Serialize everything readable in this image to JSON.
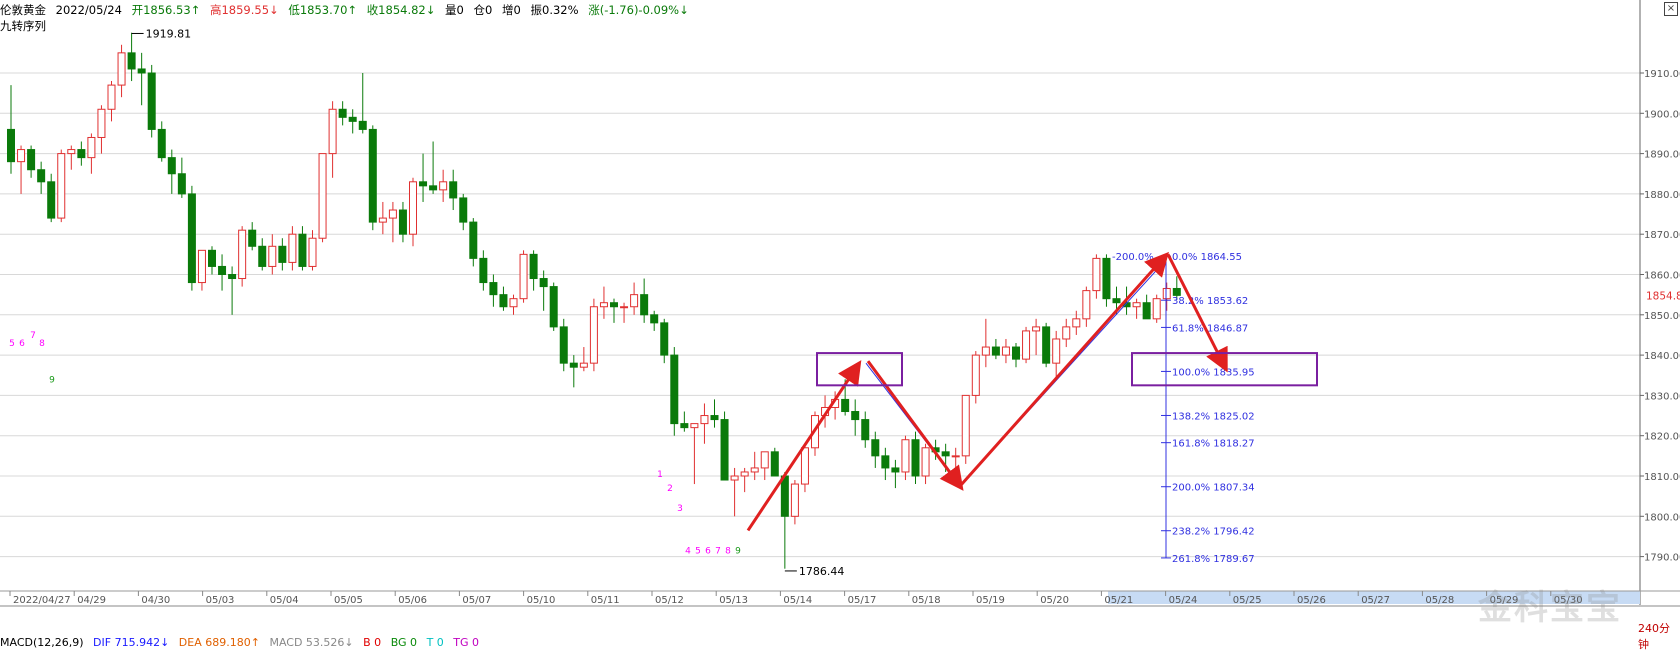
{
  "header": {
    "instrument": "伦敦黄金",
    "date": "2022/05/24",
    "open": "开1856.53↑",
    "high": "高1859.55↓",
    "low": "低1853.70↑",
    "close": "收1854.82↓",
    "volume": "量0",
    "open_interest": "仓0",
    "increase": "增0",
    "amplitude": "振0.32%",
    "change": "涨(-1.76)-0.09%↓",
    "subtitle": "九转序列"
  },
  "footer": {
    "macd_title": "MACD(12,26,9)",
    "dif": "DIF 715.942↓",
    "dea": "DEA 689.180↑",
    "macd": "MACD 53.526↓",
    "b": "B 0",
    "bg": "BG 0",
    "t": "T 0",
    "tg": "TG 0"
  },
  "watermark": "金科宝宝",
  "period_label": "240分钟",
  "colors": {
    "up": "#e03030",
    "down": "#0a7a0a",
    "fib": "#3030e0",
    "box": "#7a1fa0",
    "arrow": "#e02020"
  },
  "chart_data": {
    "type": "candlestick",
    "y_axis": {
      "ticks": [
        1790,
        1800,
        1810,
        1820,
        1830,
        1840,
        1850,
        1860,
        1870,
        1880,
        1890,
        1900,
        1910
      ],
      "range": [
        1787,
        1922
      ]
    },
    "current_price_label": "1854.82",
    "x_axis": {
      "date_labels": [
        "2022/04/27",
        "04/29",
        "04/30",
        "05/03",
        "05/04",
        "05/05",
        "05/06",
        "05/07",
        "05/10",
        "05/11",
        "05/12",
        "05/13",
        "05/14",
        "05/17",
        "05/18",
        "05/19",
        "05/20",
        "05/21",
        "05/24",
        "05/25",
        "05/26",
        "05/27",
        "05/28",
        "05/29",
        "05/30"
      ]
    },
    "candles": [
      [
        1896.0,
        1907.0,
        1885.0,
        1888.0
      ],
      [
        1888.0,
        1892.0,
        1880.0,
        1891.0
      ],
      [
        1891.0,
        1892.0,
        1884.0,
        1886.0
      ],
      [
        1886.0,
        1888.0,
        1880.0,
        1883.0
      ],
      [
        1883.0,
        1885.0,
        1873.0,
        1874.0
      ],
      [
        1874.0,
        1891.0,
        1873.0,
        1890.0
      ],
      [
        1890.0,
        1892.0,
        1886.0,
        1891.0
      ],
      [
        1891.0,
        1893.0,
        1887.0,
        1889.0
      ],
      [
        1889.0,
        1895.0,
        1885.0,
        1894.0
      ],
      [
        1894.0,
        1902.0,
        1890.0,
        1901.0
      ],
      [
        1901.0,
        1908.0,
        1898.0,
        1907.0
      ],
      [
        1907.0,
        1917.0,
        1904.0,
        1915.0
      ],
      [
        1915.0,
        1920.0,
        1908.0,
        1911.0
      ],
      [
        1911.0,
        1915.0,
        1902.0,
        1910.0
      ],
      [
        1910.0,
        1912.0,
        1894.0,
        1896.0
      ],
      [
        1896.0,
        1898.0,
        1888.0,
        1889.0
      ],
      [
        1889.0,
        1891.0,
        1880.0,
        1885.0
      ],
      [
        1885.0,
        1889.0,
        1879.0,
        1880.0
      ],
      [
        1880.0,
        1882.0,
        1856.0,
        1858.0
      ],
      [
        1858.0,
        1866.0,
        1856.0,
        1866.0
      ],
      [
        1866.0,
        1867.0,
        1860.0,
        1862.0
      ],
      [
        1862.0,
        1865.0,
        1856.0,
        1860.0
      ],
      [
        1860.0,
        1862.0,
        1850.0,
        1859.0
      ],
      [
        1859.0,
        1872.0,
        1857.0,
        1871.0
      ],
      [
        1871.0,
        1873.0,
        1866.0,
        1867.0
      ],
      [
        1867.0,
        1869.0,
        1861.0,
        1862.0
      ],
      [
        1862.0,
        1870.0,
        1860.0,
        1867.0
      ],
      [
        1867.0,
        1869.0,
        1861.0,
        1863.0
      ],
      [
        1863.0,
        1872.0,
        1861.0,
        1870.0
      ],
      [
        1870.0,
        1872.0,
        1861.0,
        1862.0
      ],
      [
        1862.0,
        1871.0,
        1861.0,
        1869.0
      ],
      [
        1869.0,
        1890.0,
        1868.0,
        1890.0
      ],
      [
        1890.0,
        1903.0,
        1884.0,
        1901.0
      ],
      [
        1901.0,
        1903.0,
        1897.0,
        1899.0
      ],
      [
        1899.0,
        1901.0,
        1895.0,
        1898.0
      ],
      [
        1898.0,
        1910.0,
        1895.0,
        1896.0
      ],
      [
        1896.0,
        1897.0,
        1871.0,
        1873.0
      ],
      [
        1873.0,
        1878.0,
        1870.0,
        1874.0
      ],
      [
        1874.0,
        1878.0,
        1868.0,
        1876.0
      ],
      [
        1876.0,
        1878.0,
        1868.0,
        1870.0
      ],
      [
        1870.0,
        1884.0,
        1867.0,
        1883.0
      ],
      [
        1883.0,
        1890.0,
        1878.0,
        1882.0
      ],
      [
        1882.0,
        1893.0,
        1880.0,
        1881.0
      ],
      [
        1881.0,
        1886.0,
        1878.0,
        1883.0
      ],
      [
        1883.0,
        1886.0,
        1876.0,
        1879.0
      ],
      [
        1879.0,
        1880.0,
        1871.0,
        1873.0
      ],
      [
        1873.0,
        1874.0,
        1862.0,
        1864.0
      ],
      [
        1864.0,
        1866.0,
        1856.0,
        1858.0
      ],
      [
        1858.0,
        1860.0,
        1852.0,
        1855.0
      ],
      [
        1855.0,
        1857.0,
        1851.0,
        1852.0
      ],
      [
        1852.0,
        1855.0,
        1850.0,
        1854.0
      ],
      [
        1854.0,
        1866.0,
        1853.0,
        1865.0
      ],
      [
        1865.0,
        1866.0,
        1856.0,
        1859.0
      ],
      [
        1859.0,
        1861.0,
        1851.0,
        1857.0
      ],
      [
        1857.0,
        1858.0,
        1846.0,
        1847.0
      ],
      [
        1847.0,
        1849.0,
        1836.0,
        1838.0
      ],
      [
        1838.0,
        1840.0,
        1832.0,
        1837.0
      ],
      [
        1837.0,
        1842.0,
        1836.0,
        1838.0
      ],
      [
        1838.0,
        1854.0,
        1836.0,
        1852.0
      ],
      [
        1852.0,
        1857.0,
        1849.0,
        1853.0
      ],
      [
        1853.0,
        1854.0,
        1848.0,
        1852.0
      ],
      [
        1852.0,
        1853.0,
        1848.0,
        1852.0
      ],
      [
        1852.0,
        1858.0,
        1850.0,
        1855.0
      ],
      [
        1855.0,
        1859.0,
        1848.0,
        1850.0
      ],
      [
        1850.0,
        1851.0,
        1846.0,
        1848.0
      ],
      [
        1848.0,
        1849.0,
        1838.0,
        1840.0
      ],
      [
        1840.0,
        1842.0,
        1820.0,
        1823.0
      ],
      [
        1823.0,
        1826.0,
        1821.0,
        1822.0
      ],
      [
        1822.0,
        1823.0,
        1808.0,
        1823.0
      ],
      [
        1823.0,
        1828.0,
        1818.0,
        1825.0
      ],
      [
        1825.0,
        1829.0,
        1822.0,
        1824.0
      ],
      [
        1824.0,
        1826.0,
        1811.0,
        1809.0
      ],
      [
        1809.0,
        1812.0,
        1800.0,
        1810.0
      ],
      [
        1810.0,
        1812.0,
        1806.0,
        1811.0
      ],
      [
        1811.0,
        1816.0,
        1809.0,
        1812.0
      ],
      [
        1812.0,
        1815.0,
        1809.0,
        1816.0
      ],
      [
        1816.0,
        1817.0,
        1810.0,
        1810.0
      ],
      [
        1810.0,
        1811.0,
        1787.0,
        1800.0
      ],
      [
        1800.0,
        1809.0,
        1798.0,
        1808.0
      ],
      [
        1808.0,
        1818.0,
        1806.0,
        1817.0
      ],
      [
        1817.0,
        1826.0,
        1815.0,
        1825.0
      ],
      [
        1825.0,
        1830.0,
        1822.0,
        1827.0
      ],
      [
        1827.0,
        1831.0,
        1824.0,
        1829.0
      ],
      [
        1829.0,
        1834.0,
        1825.0,
        1826.0
      ],
      [
        1826.0,
        1829.0,
        1820.0,
        1824.0
      ],
      [
        1824.0,
        1826.0,
        1817.0,
        1819.0
      ],
      [
        1819.0,
        1821.0,
        1812.0,
        1815.0
      ],
      [
        1815.0,
        1817.0,
        1809.0,
        1812.0
      ],
      [
        1812.0,
        1814.0,
        1807.0,
        1811.0
      ],
      [
        1811.0,
        1820.0,
        1809.0,
        1819.0
      ],
      [
        1819.0,
        1821.0,
        1808.0,
        1810.0
      ],
      [
        1810.0,
        1818.0,
        1808.0,
        1817.0
      ],
      [
        1817.0,
        1819.0,
        1814.0,
        1816.0
      ],
      [
        1816.0,
        1818.0,
        1811.0,
        1815.0
      ],
      [
        1815.0,
        1817.0,
        1812.0,
        1815.0
      ],
      [
        1815.0,
        1830.0,
        1813.0,
        1830.0
      ],
      [
        1830.0,
        1841.0,
        1828.0,
        1840.0
      ],
      [
        1840.0,
        1849.0,
        1837.0,
        1842.0
      ],
      [
        1842.0,
        1844.0,
        1839.0,
        1840.0
      ],
      [
        1840.0,
        1844.0,
        1838.0,
        1842.0
      ],
      [
        1842.0,
        1843.0,
        1837.0,
        1839.0
      ],
      [
        1839.0,
        1847.0,
        1838.0,
        1846.0
      ],
      [
        1846.0,
        1849.0,
        1840.0,
        1847.0
      ],
      [
        1847.0,
        1848.0,
        1837.0,
        1838.0
      ],
      [
        1838.0,
        1846.0,
        1834.0,
        1844.0
      ],
      [
        1844.0,
        1849.0,
        1842.0,
        1847.0
      ],
      [
        1847.0,
        1851.0,
        1845.0,
        1849.0
      ],
      [
        1849.0,
        1857.0,
        1847.0,
        1856.0
      ],
      [
        1856.0,
        1865.0,
        1854.0,
        1864.0
      ],
      [
        1864.0,
        1865.0,
        1852.0,
        1854.0
      ],
      [
        1854.0,
        1857.0,
        1850.0,
        1853.0
      ],
      [
        1853.0,
        1857.0,
        1850.0,
        1852.0
      ],
      [
        1852.0,
        1854.0,
        1849.0,
        1853.0
      ],
      [
        1853.0,
        1855.0,
        1849.0,
        1849.0
      ],
      [
        1849.0,
        1855.0,
        1848.0,
        1854.0
      ],
      [
        1854.0,
        1858.0,
        1851.0,
        1856.53
      ],
      [
        1856.53,
        1859.55,
        1853.7,
        1854.82
      ]
    ],
    "high_label": {
      "value": "1919.81"
    },
    "low_label": {
      "value": "1786.44"
    },
    "fibonacci": [
      {
        "label": "-200.0%",
        "level": "0.0%",
        "price": "1864.55"
      },
      {
        "level": "38.2%",
        "price": "1853.62"
      },
      {
        "level": "61.8%",
        "price": "1846.87"
      },
      {
        "level": "100.0%",
        "price": "1835.95"
      },
      {
        "level": "138.2%",
        "price": "1825.02"
      },
      {
        "level": "161.8%",
        "price": "1818.27"
      },
      {
        "level": "200.0%",
        "price": "1807.34"
      },
      {
        "level": "238.2%",
        "price": "1796.42"
      },
      {
        "level": "261.8%",
        "price": "1789.67"
      }
    ],
    "td_sequence": [
      {
        "label": "5",
        "color": "#ff00ff"
      },
      {
        "label": "6",
        "color": "#ff00ff"
      },
      {
        "label": "7",
        "color": "#ff00ff"
      },
      {
        "label": "8",
        "color": "#ff00ff"
      },
      {
        "label": "9",
        "color": "#1a9a1a"
      },
      {
        "label": "1",
        "color": "#ff00ff"
      },
      {
        "label": "2",
        "color": "#ff00ff"
      },
      {
        "label": "3",
        "color": "#ff00ff"
      },
      {
        "label": "4",
        "color": "#ff00ff"
      },
      {
        "label": "5",
        "color": "#ff00ff"
      },
      {
        "label": "6",
        "color": "#ff00ff"
      },
      {
        "label": "7",
        "color": "#ff00ff"
      },
      {
        "label": "8",
        "color": "#ff00ff"
      },
      {
        "label": "9",
        "color": "#1a9a1a"
      }
    ]
  }
}
